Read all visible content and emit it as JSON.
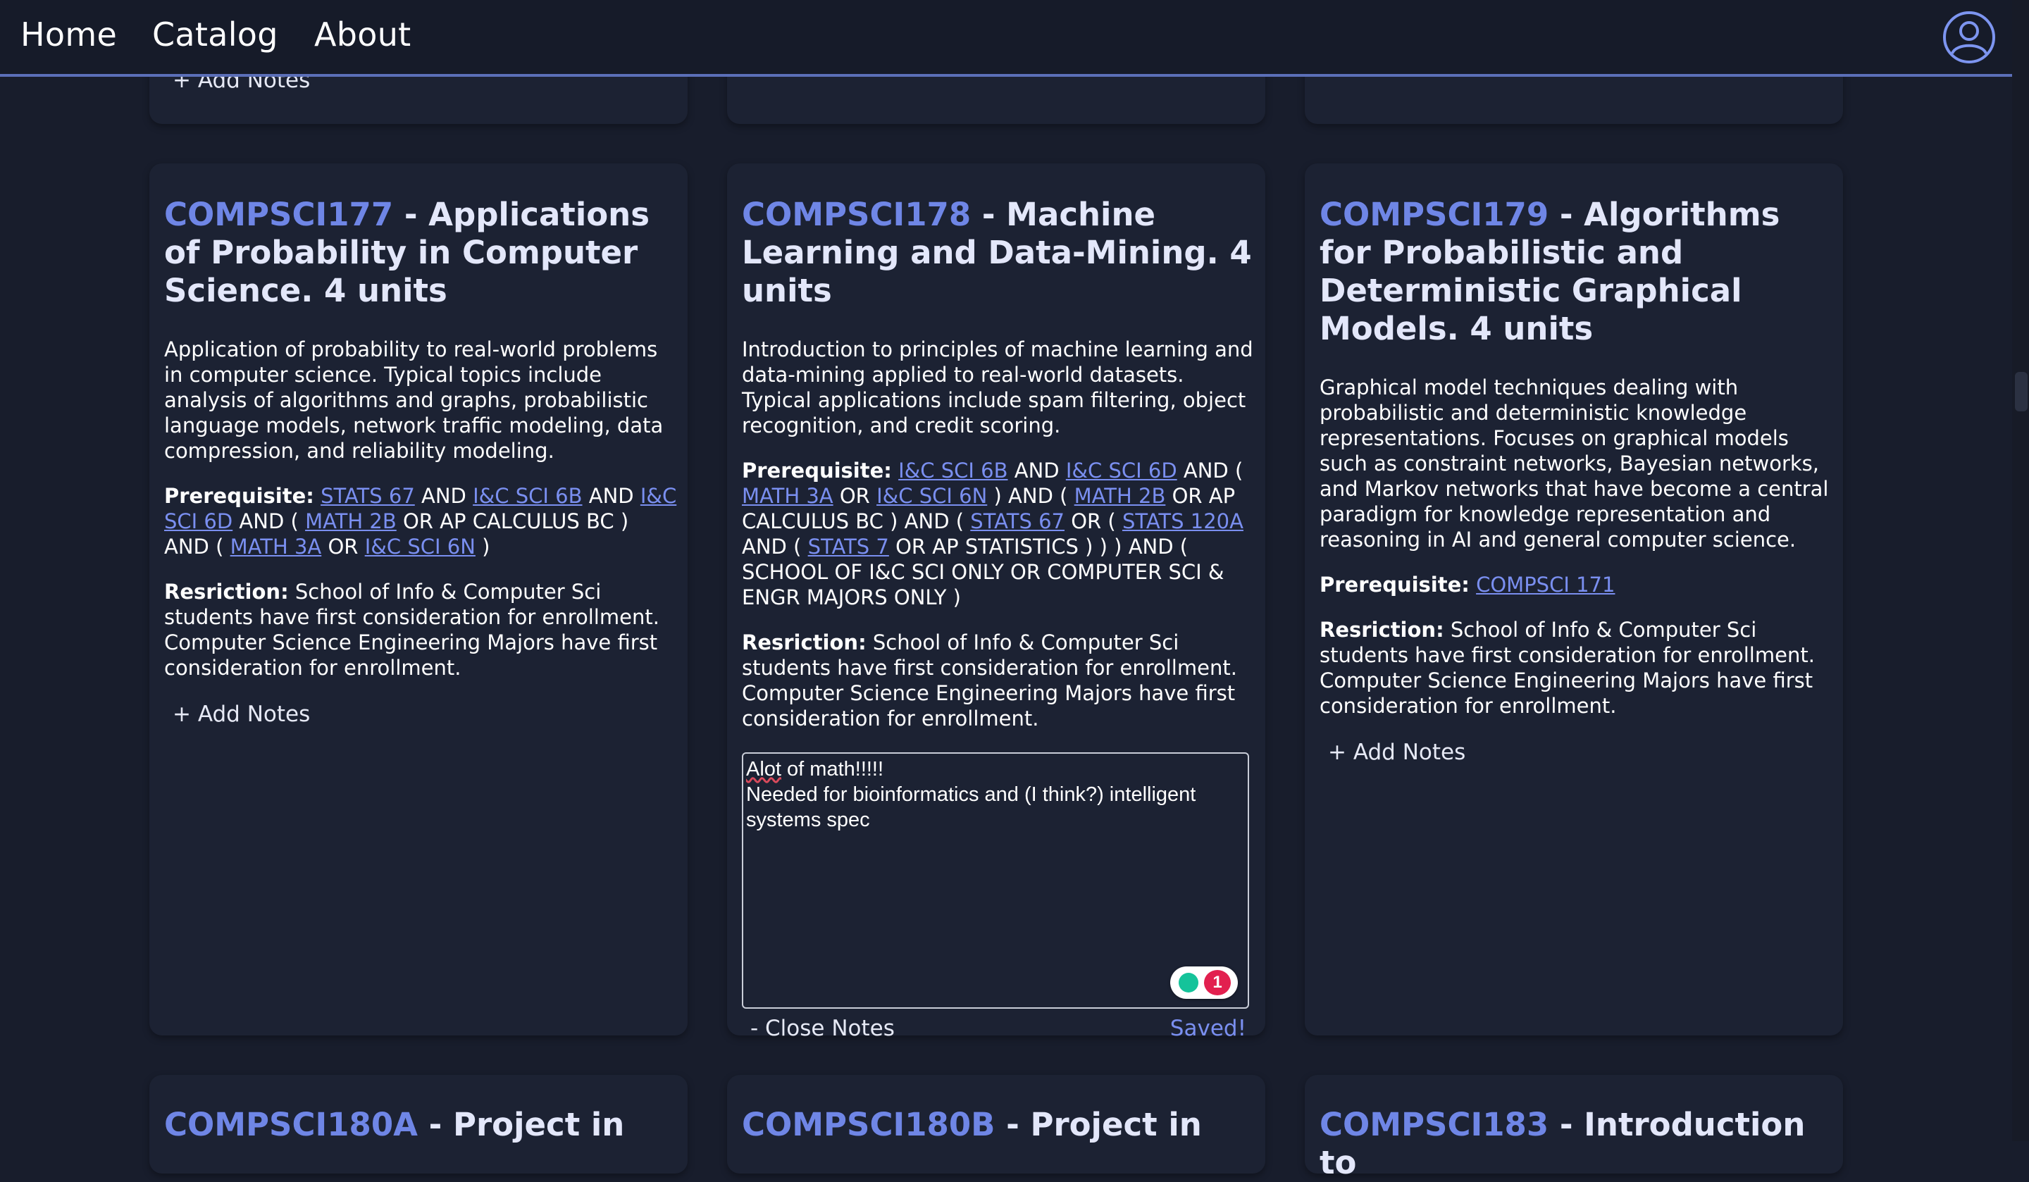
{
  "nav": {
    "home": "Home",
    "catalog": "Catalog",
    "about": "About",
    "profile_icon": "user-circle-icon"
  },
  "top_row": {
    "add_notes": "+ Add Notes"
  },
  "cards": [
    {
      "code": "COMPSCI177",
      "title_rest": " - Applications of Probability in Computer Science. 4 units",
      "description": "Application of probability to real-world problems in computer science. Typical topics include analysis of algorithms and graphs, probabilistic language models, network traffic modeling, data compression, and reliability modeling.",
      "prereq_label": "Prerequisite:",
      "prereq": [
        {
          "t": " "
        },
        {
          "l": "STATS 67"
        },
        {
          "t": " AND "
        },
        {
          "l": "I&C SCI 6B"
        },
        {
          "t": " AND "
        },
        {
          "l": "I&C SCI 6D"
        },
        {
          "t": " AND ( "
        },
        {
          "l": "MATH 2B"
        },
        {
          "t": " OR AP CALCULUS BC ) AND ( "
        },
        {
          "l": "MATH 3A"
        },
        {
          "t": " OR "
        },
        {
          "l": "I&C SCI 6N"
        },
        {
          "t": " )"
        }
      ],
      "restriction_label": "Resriction:",
      "restriction": " School of Info & Computer Sci students have first consideration for enrollment. Computer Science Engineering Majors have first consideration for enrollment.",
      "add_notes": "+ Add Notes"
    },
    {
      "code": "COMPSCI178",
      "title_rest": " - Machine Learning and Data-Mining. 4 units",
      "description": "Introduction to principles of machine learning and data-mining applied to real-world datasets. Typical applications include spam filtering, object recognition, and credit scoring.",
      "prereq_label": "Prerequisite:",
      "prereq": [
        {
          "t": " "
        },
        {
          "l": "I&C SCI 6B"
        },
        {
          "t": " AND "
        },
        {
          "l": "I&C SCI 6D"
        },
        {
          "t": " AND ( "
        },
        {
          "l": "MATH 3A"
        },
        {
          "t": " OR "
        },
        {
          "l": "I&C SCI 6N"
        },
        {
          "t": " ) AND ( "
        },
        {
          "l": "MATH 2B"
        },
        {
          "t": " OR AP CALCULUS BC ) AND ( "
        },
        {
          "l": "STATS 67"
        },
        {
          "t": " OR ( "
        },
        {
          "l": "STATS 120A"
        },
        {
          "t": " AND ( "
        },
        {
          "l": "STATS 7"
        },
        {
          "t": " OR AP STATISTICS ) ) ) AND ( SCHOOL OF I&C SCI ONLY OR COMPUTER SCI & ENGR MAJORS ONLY )"
        }
      ],
      "restriction_label": "Resriction:",
      "restriction": " School of Info & Computer Sci students have first consideration for enrollment. Computer Science Engineering Majors have first consideration for enrollment.",
      "notes": {
        "line1_word": "Alot",
        "line1_rest": " of math!!!!!",
        "line2": "Needed for bioinformatics and (I think?) intelligent",
        "line3": "systems spec",
        "grammarly_count": "1",
        "close": "- Close Notes",
        "saved": "Saved!"
      }
    },
    {
      "code": "COMPSCI179",
      "title_rest": " - Algorithms for Probabilistic and Deterministic Graphical Models. 4 units",
      "description": "Graphical model techniques dealing with probabilistic and deterministic knowledge representations. Focuses on graphical models such as constraint networks, Bayesian networks, and Markov networks that have become a central paradigm for knowledge representation and reasoning in AI and general computer science.",
      "prereq_label": "Prerequisite:",
      "prereq": [
        {
          "t": " "
        },
        {
          "l": "COMPSCI 171"
        }
      ],
      "restriction_label": "Resriction:",
      "restriction": " School of Info & Computer Sci students have first consideration for enrollment. Computer Science Engineering Majors have first consideration for enrollment.",
      "add_notes": "+ Add Notes"
    }
  ],
  "bottom_row": [
    {
      "code": "COMPSCI180A",
      "title_rest": " - Project in"
    },
    {
      "code": "COMPSCI180B",
      "title_rest": " - Project in"
    },
    {
      "code": "COMPSCI183",
      "title_rest": " - Introduction to"
    }
  ]
}
